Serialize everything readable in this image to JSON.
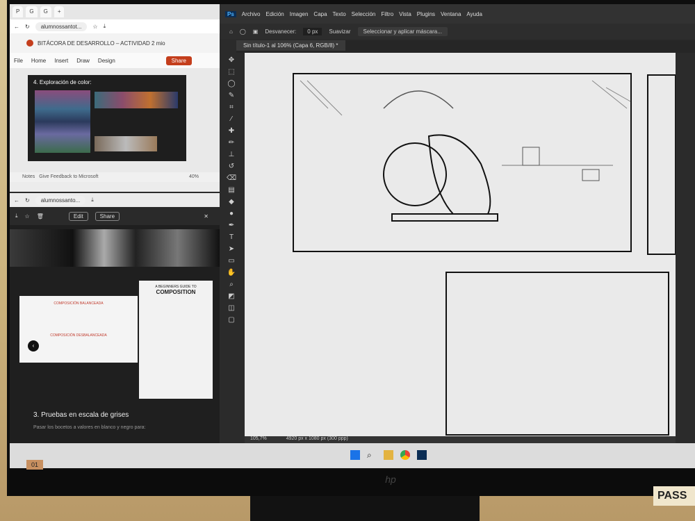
{
  "browser_top": {
    "tabs": [
      "P",
      "G",
      "G",
      "+"
    ],
    "url": "alumnossantot...",
    "doc_title": "BITÁCORA DE DESARROLLO – ACTIVIDAD 2 mio",
    "menu": [
      "File",
      "Home",
      "Insert",
      "Draw",
      "Design"
    ],
    "share_label": "Share",
    "slide_heading": "4. Exploración de color:",
    "notes_label": "Notes",
    "feedback_label": "Give Feedback to Microsoft",
    "zoom_label": "40%"
  },
  "browser_bottom": {
    "url": "alumnossanto...",
    "edit_label": "Edit",
    "share_label": "Share",
    "slide_text1": "COMPOSICIÓN BALANCEADA",
    "slide_text2": "COMPOSICIÓN DESBALANCEADA",
    "guide_title1": "A BEGINNERS GUIDE TO",
    "guide_title2": "COMPOSITION",
    "section_heading": "3. Pruebas en escala de grises",
    "section_text": "Pasar los bocetos a valores en blanco y negro para:"
  },
  "photoshop": {
    "logo": "Ps",
    "menu": [
      "Archivo",
      "Edición",
      "Imagen",
      "Capa",
      "Texto",
      "Selección",
      "Filtro",
      "Vista",
      "Plugins",
      "Ventana",
      "Ayuda"
    ],
    "feather_label": "Desvanecer:",
    "feather_value": "0 px",
    "smooth_label": "Suavizar",
    "select_mask_button": "Seleccionar y aplicar máscara...",
    "doc_tab": "Sin título-1 al 106% (Capa 6, RGB/8) *",
    "zoom": "105,7%",
    "doc_info": "4920 px x 1080 px (300 ppp)"
  },
  "monitor": {
    "sticker": "01",
    "brand": "hp",
    "pass_label": "PASS"
  }
}
